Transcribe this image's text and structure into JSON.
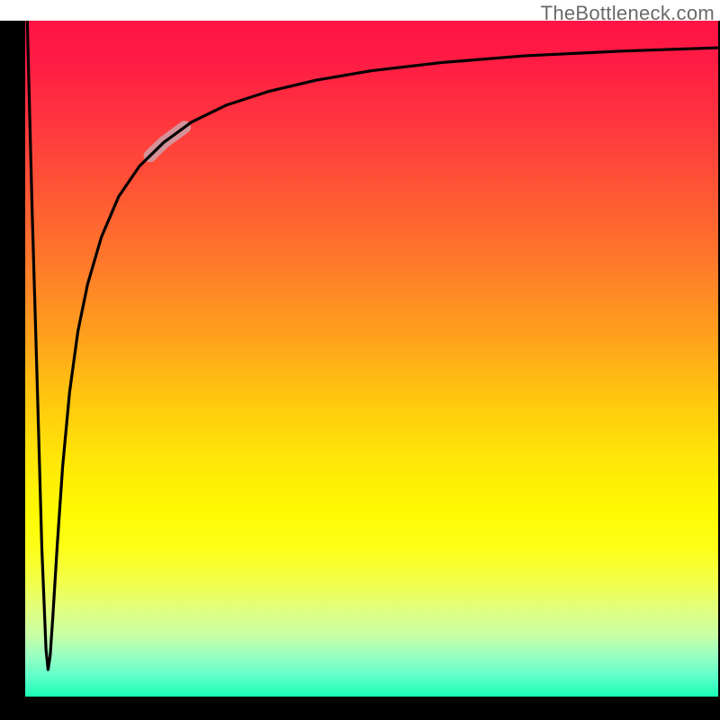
{
  "watermark": "TheBottleneck.com",
  "chart_data": {
    "type": "line",
    "title": "",
    "xlabel": "",
    "ylabel": "",
    "xlim": [
      0,
      100
    ],
    "ylim": [
      0,
      100
    ],
    "grid": false,
    "legend": false,
    "notes": "Unlabeled axes; gradient background from red (top) through orange/yellow to green (bottom). Curve: sharp dip near x≈3 to y≈4, steep rise, asymptote near y≈96. Small pale-pink segment on the rising limb around x 18–23.",
    "series": [
      {
        "name": "curve",
        "x": [
          0.3,
          1.0,
          1.8,
          2.4,
          3.0,
          3.3,
          3.6,
          4.0,
          4.6,
          5.4,
          6.4,
          7.6,
          9.0,
          11.0,
          13.5,
          16.5,
          20.0,
          24.0,
          29.0,
          35.0,
          42.0,
          50.0,
          60.0,
          72.0,
          86.0,
          100.0
        ],
        "y": [
          100.0,
          72.0,
          44.0,
          22.0,
          7.0,
          4.0,
          6.0,
          12.0,
          22.0,
          34.0,
          45.0,
          54.0,
          61.0,
          68.0,
          74.0,
          78.5,
          82.0,
          85.0,
          87.5,
          89.5,
          91.2,
          92.6,
          93.8,
          94.8,
          95.5,
          96.0
        ]
      }
    ],
    "highlight_segment": {
      "x_start": 18,
      "x_end": 23,
      "color": "#d59298",
      "width": 14
    }
  },
  "gradient_stops": [
    {
      "pos": 0,
      "color": "#ff1345"
    },
    {
      "pos": 24,
      "color": "#ff5236"
    },
    {
      "pos": 47,
      "color": "#ffa21c"
    },
    {
      "pos": 73,
      "color": "#fffb04"
    },
    {
      "pos": 100,
      "color": "#1affb5"
    }
  ]
}
